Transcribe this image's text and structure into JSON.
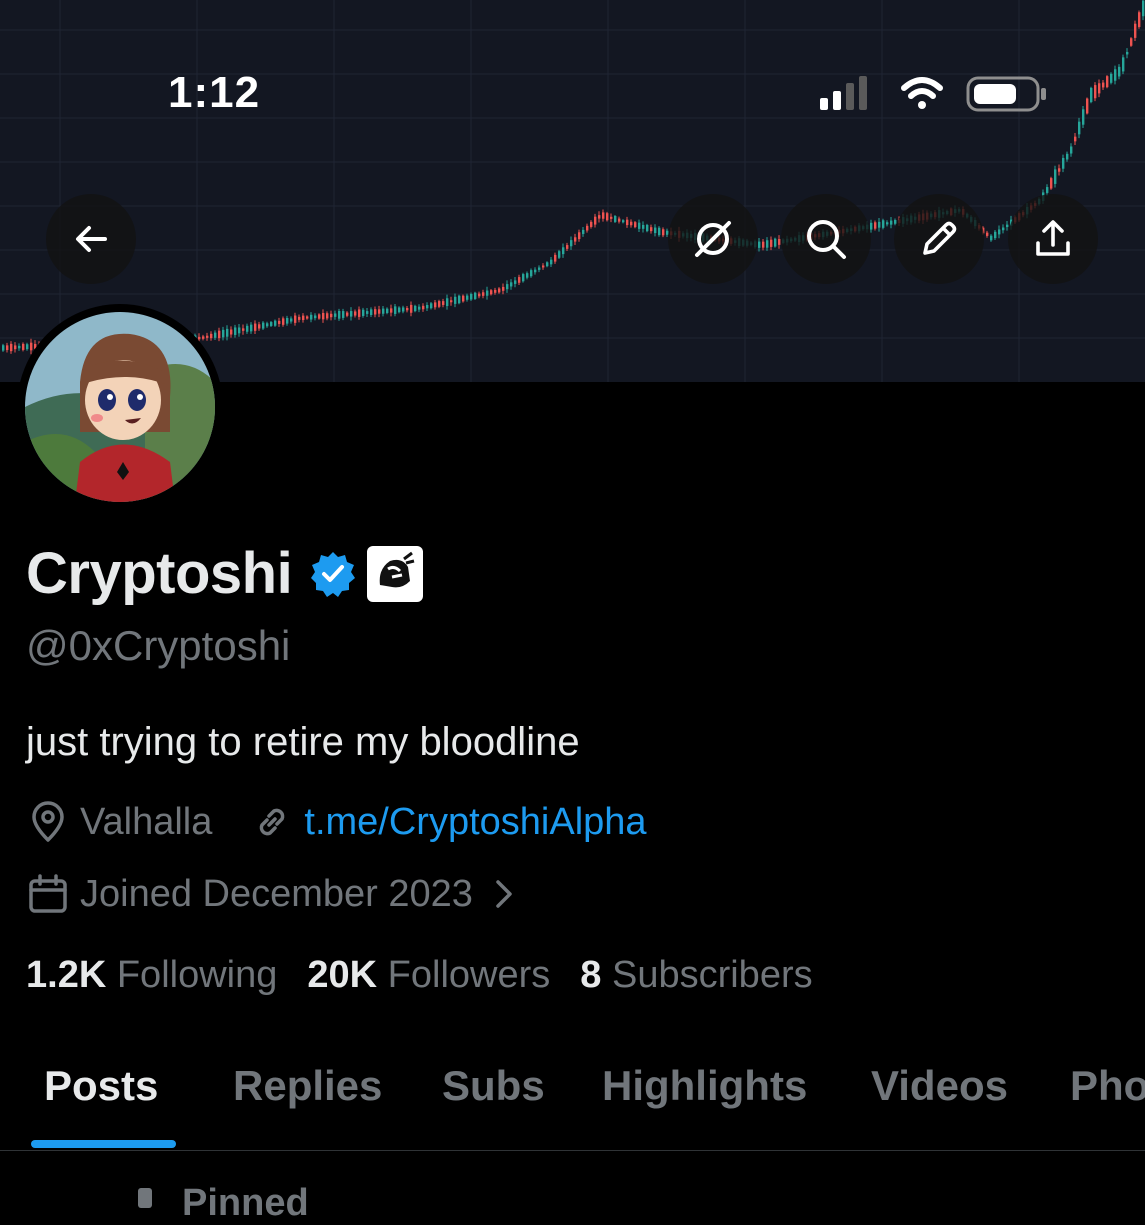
{
  "status_bar": {
    "time": "1:12"
  },
  "profile": {
    "name": "Cryptoshi",
    "handle": "@0xCryptoshi",
    "bio": "just trying to retire my bloodline",
    "location": "Valhalla",
    "link": "t.me/CryptoshiAlpha",
    "joined": "Joined December 2023"
  },
  "stats": {
    "following_count": "1.2K",
    "following_label": "Following",
    "followers_count": "20K",
    "followers_label": "Followers",
    "subscribers_count": "8",
    "subscribers_label": "Subscribers"
  },
  "tabs": [
    {
      "label": "Posts"
    },
    {
      "label": "Replies"
    },
    {
      "label": "Subs"
    },
    {
      "label": "Highlights"
    },
    {
      "label": "Videos"
    },
    {
      "label": "Pho"
    }
  ],
  "pinned_label": "Pinned",
  "colors": {
    "accent": "#1d9bf0",
    "verified": "#1d9bf0",
    "candle_up": "#26a69a",
    "candle_down": "#ef5350"
  },
  "icons": [
    "back-arrow-icon",
    "grok-icon",
    "search-icon",
    "pencil-icon",
    "share-icon",
    "location-icon",
    "link-icon",
    "calendar-icon",
    "chevron-right-icon",
    "verified-icon",
    "affiliate-badge-icon"
  ]
}
